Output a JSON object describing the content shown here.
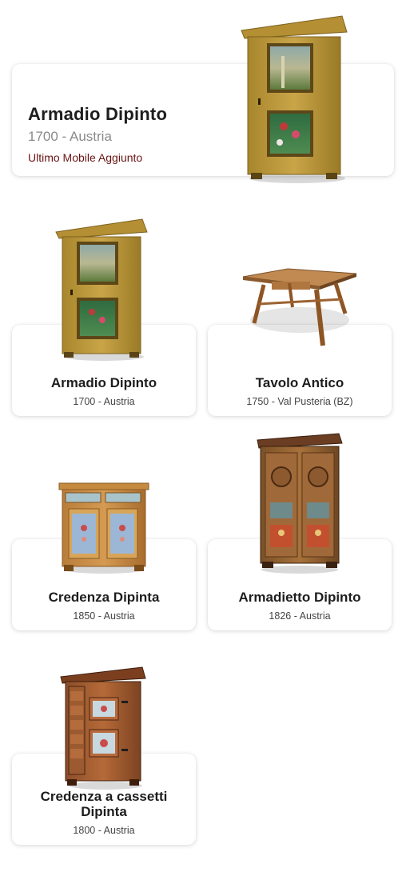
{
  "featured": {
    "title": "Armadio Dipinto",
    "subtitle": "1700 - Austria",
    "tag": "Ultimo Mobile Aggiunto",
    "image": "painted-wardrobe"
  },
  "items": [
    {
      "title": "Armadio Dipinto",
      "subtitle": "1700 - Austria",
      "image": "painted-wardrobe"
    },
    {
      "title": "Tavolo Antico",
      "subtitle": "1750 - Val Pusteria (BZ)",
      "image": "antique-table"
    },
    {
      "title": "Credenza Dipinta",
      "subtitle": "1850 - Austria",
      "image": "painted-sideboard"
    },
    {
      "title": "Armadietto Dipinto",
      "subtitle": "1826 - Austria",
      "image": "painted-cabinet"
    },
    {
      "title": "Credenza a cassetti Dipinta",
      "subtitle": "1800 - Austria",
      "image": "drawer-cabinet"
    }
  ],
  "colors": {
    "accent": "#6a1414",
    "card": "#ffffff"
  }
}
